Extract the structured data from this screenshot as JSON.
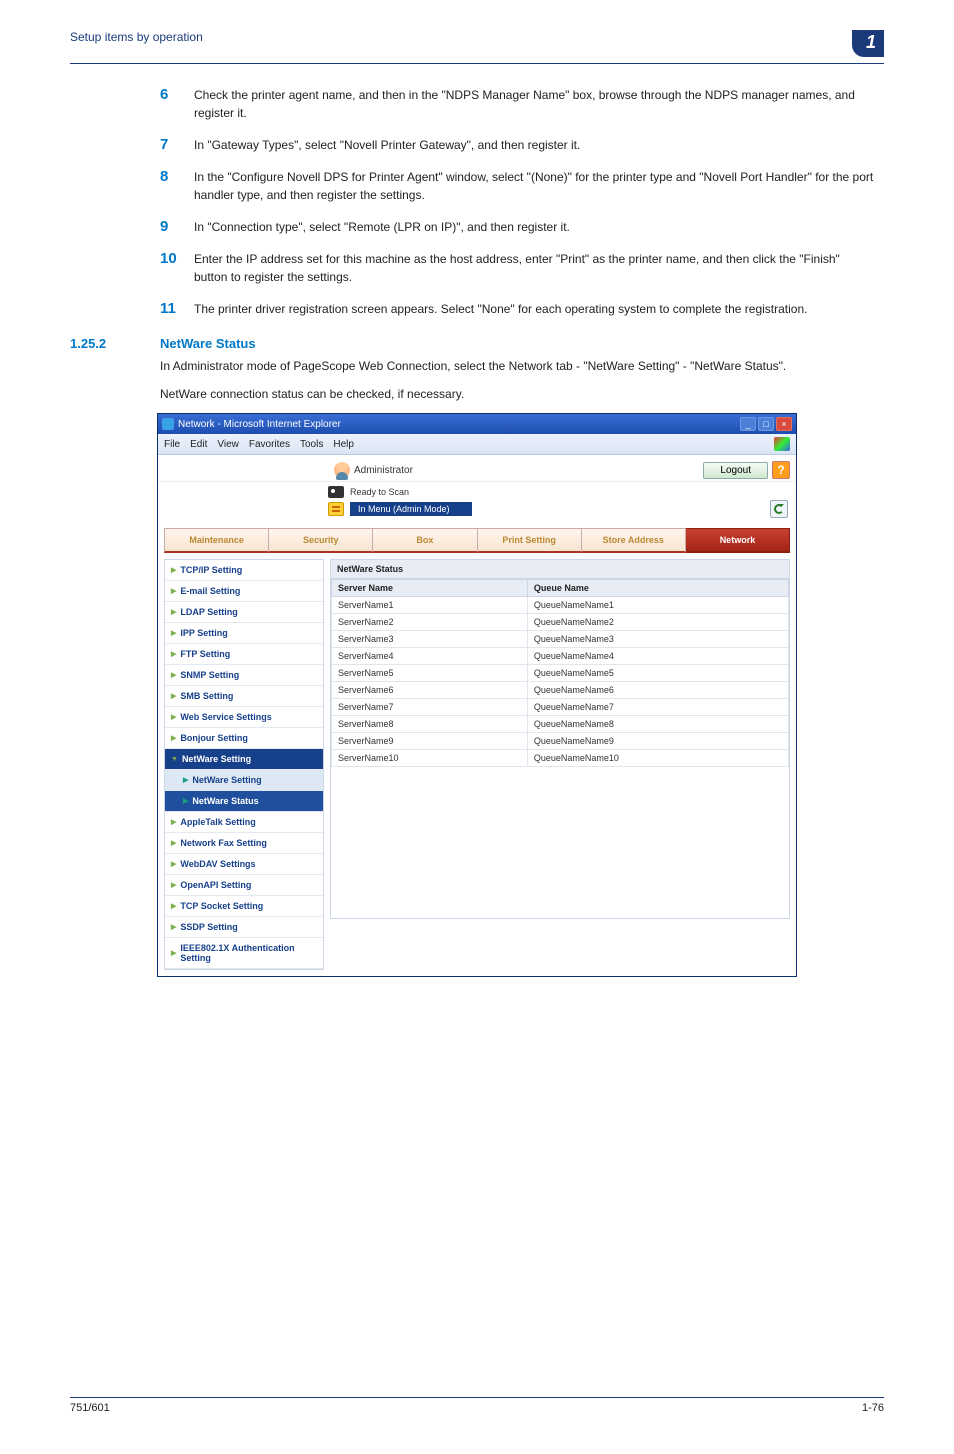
{
  "header": {
    "title": "Setup items by operation",
    "chapter": "1"
  },
  "steps": [
    {
      "n": "6",
      "t": "Check the printer agent name, and then in the \"NDPS Manager Name\" box, browse through the NDPS manager names, and register it."
    },
    {
      "n": "7",
      "t": "In \"Gateway Types\", select \"Novell Printer Gateway\", and then register it."
    },
    {
      "n": "8",
      "t": "In the \"Configure Novell DPS for Printer Agent\" window, select \"(None)\" for the printer type and \"Novell Port Handler\" for the port handler type, and then register the settings."
    },
    {
      "n": "9",
      "t": "In \"Connection type\", select \"Remote (LPR on IP)\", and then register it."
    },
    {
      "n": "10",
      "t": "Enter the IP address set for this machine as the host address, enter \"Print\" as the printer name, and then click the \"Finish\" button to register the settings."
    },
    {
      "n": "11",
      "t": "The printer driver registration screen appears. Select \"None\" for each operating system to complete the registration."
    }
  ],
  "section": {
    "num": "1.25.2",
    "title": "NetWare Status"
  },
  "para1": "In Administrator mode of PageScope Web Connection, select the Network tab - \"NetWare Setting\" - \"NetWare Status\".",
  "para2": "NetWare connection status can be checked, if necessary.",
  "ie": {
    "title": "Network - Microsoft Internet Explorer",
    "menus": [
      "File",
      "Edit",
      "View",
      "Favorites",
      "Tools",
      "Help"
    ]
  },
  "app": {
    "admin_label": "Administrator",
    "logout": "Logout",
    "help": "?",
    "status": "Ready to Scan",
    "mode": "In Menu (Admin Mode)"
  },
  "tabs": [
    "Maintenance",
    "Security",
    "Box",
    "Print Setting",
    "Store Address",
    "Network"
  ],
  "active_tab": 5,
  "sidebar": [
    {
      "label": "TCP/IP Setting"
    },
    {
      "label": "E-mail Setting"
    },
    {
      "label": "LDAP Setting"
    },
    {
      "label": "IPP Setting"
    },
    {
      "label": "FTP Setting"
    },
    {
      "label": "SNMP Setting"
    },
    {
      "label": "SMB Setting"
    },
    {
      "label": "Web Service Settings"
    },
    {
      "label": "Bonjour Setting"
    }
  ],
  "sidebar_expanded": {
    "label": "NetWare Setting",
    "children": [
      {
        "label": "NetWare Setting",
        "sel": false
      },
      {
        "label": "NetWare Status",
        "sel": true
      }
    ]
  },
  "sidebar_after": [
    {
      "label": "AppleTalk Setting"
    },
    {
      "label": "Network Fax Setting"
    },
    {
      "label": "WebDAV Settings"
    },
    {
      "label": "OpenAPI Setting"
    },
    {
      "label": "TCP Socket Setting"
    },
    {
      "label": "SSDP Setting"
    },
    {
      "label": "IEEE802.1X Authentication Setting"
    }
  ],
  "panel": {
    "title": "NetWare Status",
    "cols": [
      "Server Name",
      "Queue Name"
    ],
    "rows": [
      [
        "ServerName1",
        "QueueNameName1"
      ],
      [
        "ServerName2",
        "QueueNameName2"
      ],
      [
        "ServerName3",
        "QueueNameName3"
      ],
      [
        "ServerName4",
        "QueueNameName4"
      ],
      [
        "ServerName5",
        "QueueNameName5"
      ],
      [
        "ServerName6",
        "QueueNameName6"
      ],
      [
        "ServerName7",
        "QueueNameName7"
      ],
      [
        "ServerName8",
        "QueueNameName8"
      ],
      [
        "ServerName9",
        "QueueNameName9"
      ],
      [
        "ServerName10",
        "QueueNameName10"
      ]
    ]
  },
  "footer": {
    "left": "751/601",
    "right": "1-76"
  }
}
